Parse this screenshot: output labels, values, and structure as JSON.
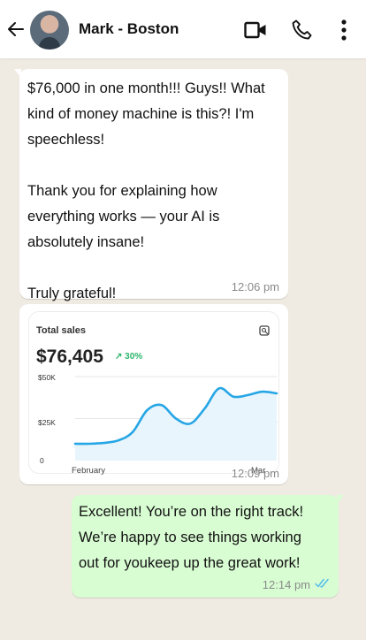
{
  "header": {
    "contact_name": "Mark - Boston",
    "icons": [
      "back-arrow-icon",
      "video-call-icon",
      "phone-icon",
      "more-vertical-icon"
    ]
  },
  "messages": [
    {
      "direction": "incoming",
      "text": "$76,000 in one month!!! Guys!! What\nkind of money machine is this?! I'm\nspeechless!\n\nThank you for explaining how\neverything works — your AI is\nabsolutely insane!\n\nTruly grateful!",
      "time": "12:06 pm"
    },
    {
      "direction": "incoming",
      "type": "image",
      "time": "12:09 pm"
    },
    {
      "direction": "outgoing",
      "text": "Excellent! You’re on the right track!\nWe’re happy to see things working\nout for youkeep up the great work!",
      "time": "12:14 pm",
      "status": "read"
    }
  ],
  "chart_data": {
    "type": "line",
    "title": "Total sales",
    "value": "$76,405",
    "delta": "↗ 30%",
    "x_labels": [
      "February",
      "Mar"
    ],
    "y_ticks": [
      "$50K",
      "$25K",
      "0"
    ],
    "ylim": [
      0,
      50000
    ],
    "series": [
      {
        "style": "solid",
        "color": "#27a6e5",
        "values": [
          10000,
          10000,
          10500,
          12000,
          17000,
          30000,
          33000,
          25000,
          22000,
          31000,
          43000,
          38000,
          39000,
          41000,
          40000
        ]
      },
      {
        "style": "dashed",
        "color": "#9fd3ef",
        "values": [
          8000,
          8500,
          9000,
          10500,
          14000,
          18500,
          19500,
          17500,
          17000,
          20500,
          24000,
          23000,
          23500,
          22500,
          23000
        ]
      }
    ],
    "grid": true
  },
  "colors": {
    "background": "#efeae2",
    "incoming": "#ffffff",
    "outgoing": "#d9fdd3",
    "read_ticks": "#53bdeb"
  }
}
